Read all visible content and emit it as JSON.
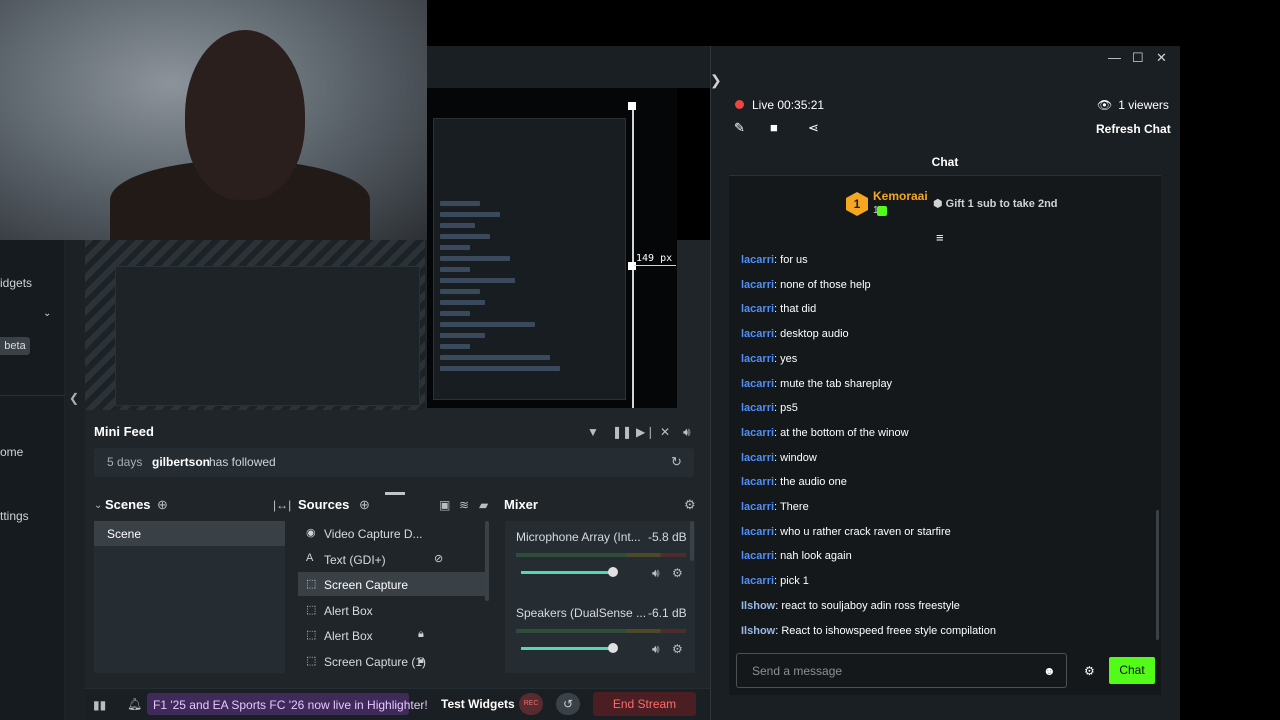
{
  "left_nav": {
    "items": [
      {
        "label": "idgets"
      },
      {
        "label": "ome"
      },
      {
        "label": "ttings"
      }
    ],
    "beta_label": "beta"
  },
  "preview": {
    "dimension_label": "149 px"
  },
  "mini_feed": {
    "title": "Mini Feed",
    "event": {
      "age": "5 days",
      "user": "gilbertson",
      "action": "has followed"
    }
  },
  "scenes": {
    "title": "Scenes",
    "items": [
      "Scene"
    ]
  },
  "sources": {
    "title": "Sources",
    "items": [
      {
        "label": "Video Capture D...",
        "icon": "camera-icon"
      },
      {
        "label": "Text (GDI+)",
        "icon": "text-icon"
      },
      {
        "label": "Screen Capture",
        "icon": "screen-icon",
        "selected": true
      },
      {
        "label": "Alert Box",
        "icon": "alert-icon"
      },
      {
        "label": "Alert Box",
        "icon": "alert-icon"
      },
      {
        "label": "Screen Capture (1)",
        "icon": "screen-icon"
      }
    ]
  },
  "mixer": {
    "title": "Mixer",
    "channels": [
      {
        "name": "Microphone Array (Int...",
        "db": "-5.8 dB",
        "level": 0.8
      },
      {
        "name": "Speakers (DualSense ...",
        "db": "-6.1 dB",
        "level": 0.8
      }
    ]
  },
  "bottom_bar": {
    "highlight": "F1 '25 and EA Sports FC '26 now live in Highlighter!",
    "test_widgets": "Test Widgets",
    "rec_label": "REC",
    "end_stream": "End Stream"
  },
  "chat": {
    "live_label": "Live",
    "live_time": "00:35:21",
    "viewers": "1 viewers",
    "refresh": "Refresh Chat",
    "panel_title": "Chat",
    "top_gifter": {
      "name": "Kemoraai",
      "rank": "1",
      "count": "1"
    },
    "gift_prompt": "Gift 1 sub to take 2nd",
    "messages": [
      {
        "user": "lacarri",
        "text": "for us",
        "style": "u"
      },
      {
        "user": "lacarri",
        "text": "none of those help",
        "style": "u"
      },
      {
        "user": "lacarri",
        "text": "that did",
        "style": "u"
      },
      {
        "user": "lacarri",
        "text": "desktop audio",
        "style": "u"
      },
      {
        "user": "lacarri",
        "text": "yes",
        "style": "u"
      },
      {
        "user": "lacarri",
        "text": "mute the tab shareplay",
        "style": "u"
      },
      {
        "user": "lacarri",
        "text": "ps5",
        "style": "u"
      },
      {
        "user": "lacarri",
        "text": "at the bottom of the winow",
        "style": "u"
      },
      {
        "user": "lacarri",
        "text": "window",
        "style": "u"
      },
      {
        "user": "lacarri",
        "text": "the audio one",
        "style": "u"
      },
      {
        "user": "lacarri",
        "text": "There",
        "style": "u"
      },
      {
        "user": "lacarri",
        "text": "who u rather crack raven or starfire",
        "style": "u"
      },
      {
        "user": "lacarri",
        "text": "nah look again",
        "style": "u"
      },
      {
        "user": "lacarri",
        "text": "pick 1",
        "style": "u"
      },
      {
        "user": "Ilshow",
        "text": "react to souljaboy adin ross freestyle",
        "style": "u2"
      },
      {
        "user": "Ilshow",
        "text": "React to ishowspeed freee style compilation",
        "style": "u2"
      }
    ],
    "input_placeholder": "Send a message",
    "send_label": "Chat"
  },
  "colors": {
    "accent_green": "#53fc18",
    "live_red": "#ef4444",
    "username_blue": "#4f8ff7",
    "gifter_gold": "#f5a623"
  }
}
